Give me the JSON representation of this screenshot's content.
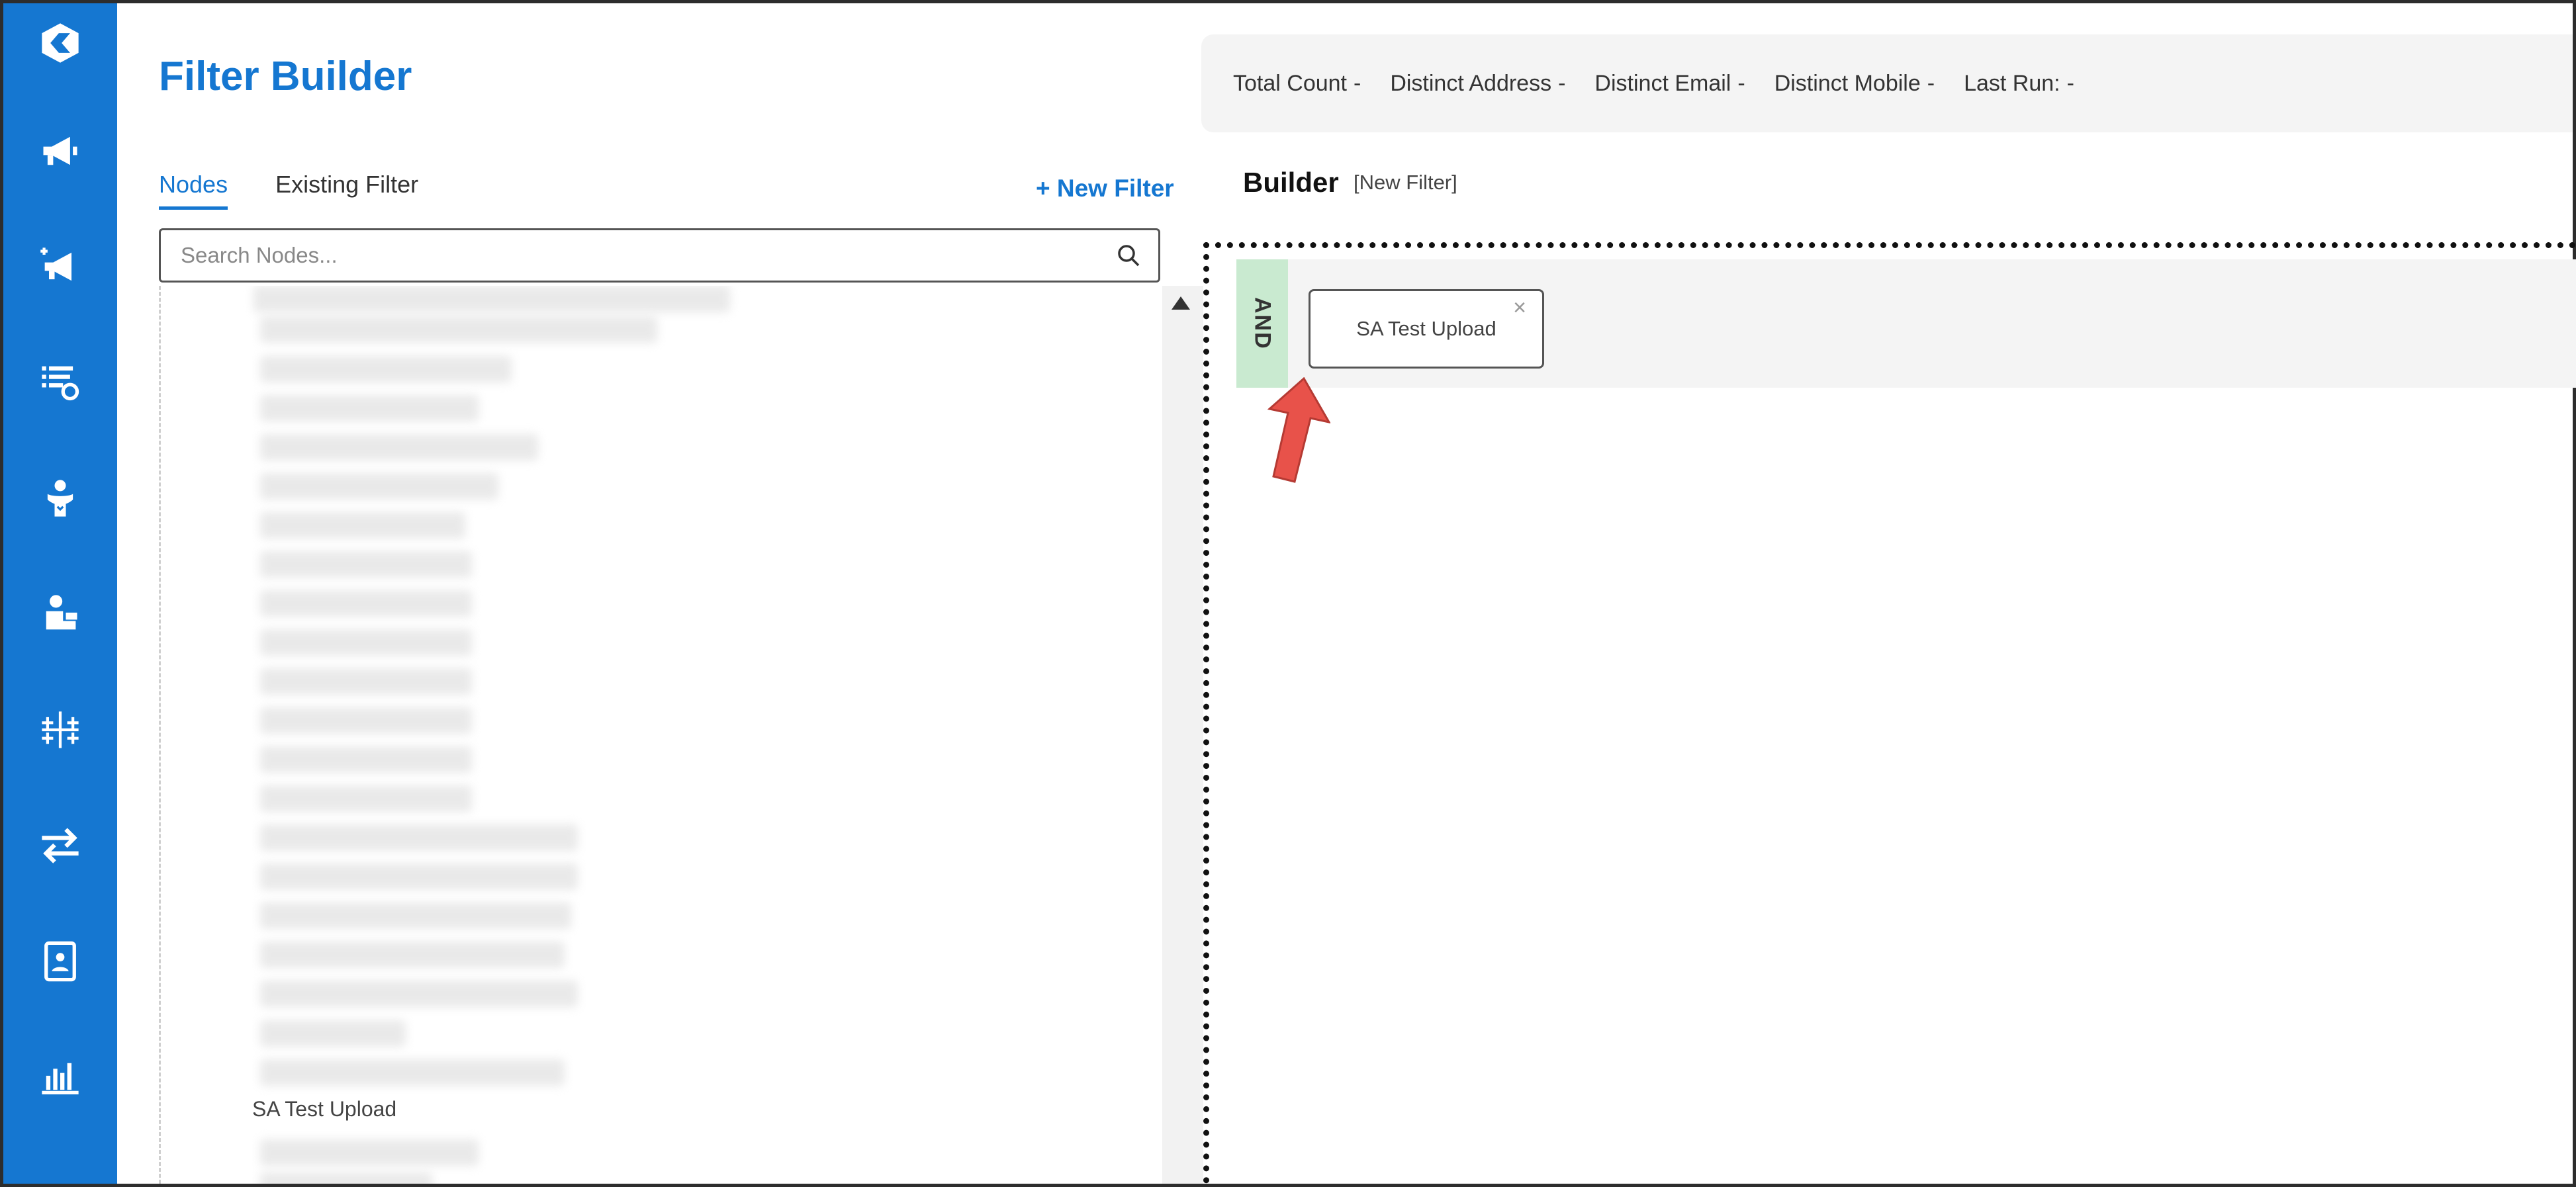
{
  "app": {
    "title": "Filter Builder"
  },
  "sidebar": {
    "items": [
      {
        "name": "logo-icon"
      },
      {
        "name": "megaphone-icon"
      },
      {
        "name": "megaphone-add-icon"
      },
      {
        "name": "list-settings-icon"
      },
      {
        "name": "person-heart-icon"
      },
      {
        "name": "person-laptop-icon"
      },
      {
        "name": "network-icon"
      },
      {
        "name": "transfer-arrows-icon"
      },
      {
        "name": "contact-card-icon"
      },
      {
        "name": "bar-chart-icon"
      }
    ]
  },
  "stats": {
    "items": [
      {
        "label": "Total Count",
        "value": "-"
      },
      {
        "label": "Distinct Address",
        "value": "-"
      },
      {
        "label": "Distinct Email",
        "value": "-"
      },
      {
        "label": "Distinct Mobile",
        "value": "-"
      },
      {
        "label": "Last Run:",
        "value": "-"
      }
    ]
  },
  "tabs": {
    "nodes": "Nodes",
    "existing": "Existing Filter",
    "active": "nodes"
  },
  "actions": {
    "new_filter": "+ New Filter"
  },
  "search": {
    "placeholder": "Search Nodes...",
    "value": ""
  },
  "node_list": {
    "visible_item": "SA Test Upload"
  },
  "builder": {
    "title": "Builder",
    "subtitle": "[New Filter]",
    "group_operator": "AND",
    "conditions": [
      {
        "label": "SA Test Upload",
        "close": "×"
      }
    ]
  },
  "colors": {
    "brand": "#1577d1",
    "and_tag": "#c9ead0",
    "arrow": "#e8524a"
  }
}
